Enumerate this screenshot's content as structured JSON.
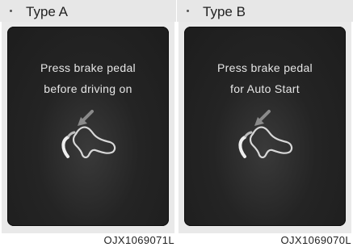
{
  "panels": [
    {
      "type_label": "Type A",
      "message_line1": "Press brake pedal",
      "message_line2": "before driving on",
      "icon": "brake-pedal-foot-icon",
      "figure_code": "OJX1069071L"
    },
    {
      "type_label": "Type B",
      "message_line1": "Press brake pedal",
      "message_line2": "for Auto Start",
      "icon": "brake-pedal-foot-icon",
      "figure_code": "OJX1069070L"
    }
  ],
  "colors": {
    "screen_bg": "#1d1d1d",
    "message_text": "#e6e6e6",
    "header_bg": "#e7e7e7"
  }
}
